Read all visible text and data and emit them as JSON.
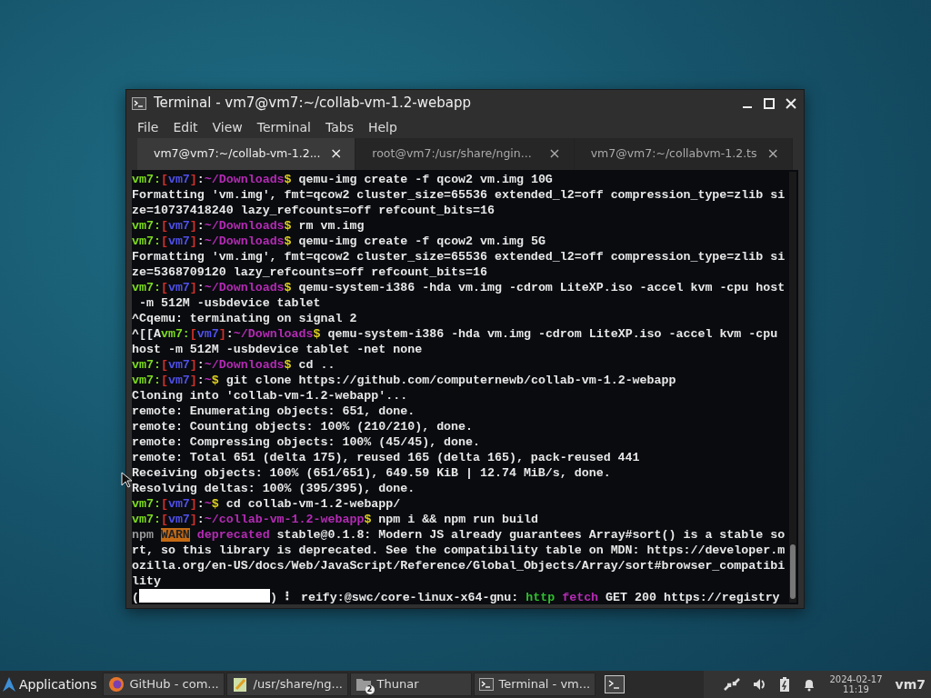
{
  "window": {
    "title": "Terminal - vm7@vm7:~/collab-vm-1.2-webapp"
  },
  "menu": [
    "File",
    "Edit",
    "View",
    "Terminal",
    "Tabs",
    "Help"
  ],
  "tabs": [
    {
      "label": "vm7@vm7:~/collab-vm-1.2...",
      "close": "×",
      "selected": true
    },
    {
      "label": "root@vm7:/usr/share/ngin...",
      "close": "×",
      "selected": false
    },
    {
      "label": "vm7@vm7:~/collabvm-1.2.ts",
      "close": "×",
      "selected": false
    }
  ],
  "terminal_lines": [
    [
      {
        "kind": "user",
        "text": "vm7:"
      },
      {
        "kind": "br",
        "text": "["
      },
      {
        "kind": "host",
        "text": "vm7"
      },
      {
        "kind": "br",
        "text": "]"
      },
      {
        "kind": "plain",
        "text": ":"
      },
      {
        "kind": "path",
        "text": "~/Downloads"
      },
      {
        "kind": "dollar",
        "text": "$"
      },
      {
        "kind": "plain",
        "text": " qemu-img create -f qcow2 vm.img 10G"
      }
    ],
    [
      {
        "kind": "plain",
        "text": "Formatting 'vm.img', fmt=qcow2 cluster_size=65536 extended_l2=off compression_type=zlib si"
      }
    ],
    [
      {
        "kind": "plain",
        "text": "ze=10737418240 lazy_refcounts=off refcount_bits=16"
      }
    ],
    [
      {
        "kind": "user",
        "text": "vm7:"
      },
      {
        "kind": "br",
        "text": "["
      },
      {
        "kind": "host",
        "text": "vm7"
      },
      {
        "kind": "br",
        "text": "]"
      },
      {
        "kind": "plain",
        "text": ":"
      },
      {
        "kind": "path",
        "text": "~/Downloads"
      },
      {
        "kind": "dollar",
        "text": "$"
      },
      {
        "kind": "plain",
        "text": " rm vm.img"
      }
    ],
    [
      {
        "kind": "user",
        "text": "vm7:"
      },
      {
        "kind": "br",
        "text": "["
      },
      {
        "kind": "host",
        "text": "vm7"
      },
      {
        "kind": "br",
        "text": "]"
      },
      {
        "kind": "plain",
        "text": ":"
      },
      {
        "kind": "path",
        "text": "~/Downloads"
      },
      {
        "kind": "dollar",
        "text": "$"
      },
      {
        "kind": "plain",
        "text": " qemu-img create -f qcow2 vm.img 5G"
      }
    ],
    [
      {
        "kind": "plain",
        "text": "Formatting 'vm.img', fmt=qcow2 cluster_size=65536 extended_l2=off compression_type=zlib si"
      }
    ],
    [
      {
        "kind": "plain",
        "text": "ze=5368709120 lazy_refcounts=off refcount_bits=16"
      }
    ],
    [
      {
        "kind": "user",
        "text": "vm7:"
      },
      {
        "kind": "br",
        "text": "["
      },
      {
        "kind": "host",
        "text": "vm7"
      },
      {
        "kind": "br",
        "text": "]"
      },
      {
        "kind": "plain",
        "text": ":"
      },
      {
        "kind": "path",
        "text": "~/Downloads"
      },
      {
        "kind": "dollar",
        "text": "$"
      },
      {
        "kind": "plain",
        "text": " qemu-system-i386 -hda vm.img -cdrom LiteXP.iso -accel kvm -cpu host"
      }
    ],
    [
      {
        "kind": "plain",
        "text": " -m 512M -usbdevice tablet"
      }
    ],
    [
      {
        "kind": "plain",
        "text": "^Cqemu: terminating on signal 2"
      }
    ],
    [
      {
        "kind": "plain",
        "text": "^[[A"
      },
      {
        "kind": "user",
        "text": "vm7:"
      },
      {
        "kind": "br",
        "text": "["
      },
      {
        "kind": "host",
        "text": "vm7"
      },
      {
        "kind": "br",
        "text": "]"
      },
      {
        "kind": "plain",
        "text": ":"
      },
      {
        "kind": "path",
        "text": "~/Downloads"
      },
      {
        "kind": "dollar",
        "text": "$"
      },
      {
        "kind": "plain",
        "text": " qemu-system-i386 -hda vm.img -cdrom LiteXP.iso -accel kvm -cpu"
      }
    ],
    [
      {
        "kind": "plain",
        "text": "host -m 512M -usbdevice tablet -net none"
      }
    ],
    [
      {
        "kind": "user",
        "text": "vm7:"
      },
      {
        "kind": "br",
        "text": "["
      },
      {
        "kind": "host",
        "text": "vm7"
      },
      {
        "kind": "br",
        "text": "]"
      },
      {
        "kind": "plain",
        "text": ":"
      },
      {
        "kind": "path",
        "text": "~/Downloads"
      },
      {
        "kind": "dollar",
        "text": "$"
      },
      {
        "kind": "plain",
        "text": " cd .."
      }
    ],
    [
      {
        "kind": "user",
        "text": "vm7:"
      },
      {
        "kind": "br",
        "text": "["
      },
      {
        "kind": "host",
        "text": "vm7"
      },
      {
        "kind": "br",
        "text": "]"
      },
      {
        "kind": "plain",
        "text": ":"
      },
      {
        "kind": "path",
        "text": "~"
      },
      {
        "kind": "dollar",
        "text": "$"
      },
      {
        "kind": "plain",
        "text": " git clone https://github.com/computernewb/collab-vm-1.2-webapp"
      }
    ],
    [
      {
        "kind": "plain",
        "text": "Cloning into 'collab-vm-1.2-webapp'..."
      }
    ],
    [
      {
        "kind": "plain",
        "text": "remote: Enumerating objects: 651, done."
      }
    ],
    [
      {
        "kind": "plain",
        "text": "remote: Counting objects: 100% (210/210), done."
      }
    ],
    [
      {
        "kind": "plain",
        "text": "remote: Compressing objects: 100% (45/45), done."
      }
    ],
    [
      {
        "kind": "plain",
        "text": "remote: Total 651 (delta 175), reused 165 (delta 165), pack-reused 441"
      }
    ],
    [
      {
        "kind": "plain",
        "text": "Receiving objects: 100% (651/651), 649.59 KiB | 12.74 MiB/s, done."
      }
    ],
    [
      {
        "kind": "plain",
        "text": "Resolving deltas: 100% (395/395), done."
      }
    ],
    [
      {
        "kind": "user",
        "text": "vm7:"
      },
      {
        "kind": "br",
        "text": "["
      },
      {
        "kind": "host",
        "text": "vm7"
      },
      {
        "kind": "br",
        "text": "]"
      },
      {
        "kind": "plain",
        "text": ":"
      },
      {
        "kind": "path",
        "text": "~"
      },
      {
        "kind": "dollar",
        "text": "$"
      },
      {
        "kind": "plain",
        "text": " cd collab-vm-1.2-webapp/"
      }
    ],
    [
      {
        "kind": "user",
        "text": "vm7:"
      },
      {
        "kind": "br",
        "text": "["
      },
      {
        "kind": "host",
        "text": "vm7"
      },
      {
        "kind": "br",
        "text": "]"
      },
      {
        "kind": "plain",
        "text": ":"
      },
      {
        "kind": "path",
        "text": "~/collab-vm-1.2-webapp"
      },
      {
        "kind": "dollar",
        "text": "$"
      },
      {
        "kind": "plain",
        "text": " npm i && npm run build"
      }
    ],
    [
      {
        "kind": "dim",
        "text": "npm "
      },
      {
        "kind": "warn",
        "text": "WARN"
      },
      {
        "kind": "magenta",
        "text": " deprecated"
      },
      {
        "kind": "plain",
        "text": " stable@0.1.8: Modern JS already guarantees Array#sort() is a stable so"
      }
    ],
    [
      {
        "kind": "plain",
        "text": "rt, so this library is deprecated. See the compatibility table on MDN: https://developer.m"
      }
    ],
    [
      {
        "kind": "plain",
        "text": "ozilla.org/en-US/docs/Web/JavaScript/Reference/Global_Objects/Array/sort#browser_compatibi"
      }
    ],
    [
      {
        "kind": "plain",
        "text": "lity"
      }
    ],
    [
      {
        "kind": "plain",
        "text": "("
      },
      {
        "kind": "bar",
        "level": 1
      },
      {
        "kind": "plain",
        "text": ") ⠇ reify:@swc/core-linux-x64-gnu: "
      },
      {
        "kind": "green",
        "text": "http"
      },
      {
        "kind": "magenta",
        "text": " fetch"
      },
      {
        "kind": "plain",
        "text": " GET 200 https://registry"
      }
    ]
  ],
  "taskbar": {
    "menu": "Applications",
    "tasks": [
      {
        "kind": "browser",
        "label": "GitHub - com..."
      },
      {
        "kind": "editor",
        "label": "/usr/share/ng..."
      },
      {
        "kind": "folder",
        "label": "Thunar",
        "count": "2"
      },
      {
        "kind": "terminal",
        "label": "Terminal - vm..."
      }
    ],
    "date": "2024-02-17",
    "time": "11:19",
    "user": "vm7"
  }
}
